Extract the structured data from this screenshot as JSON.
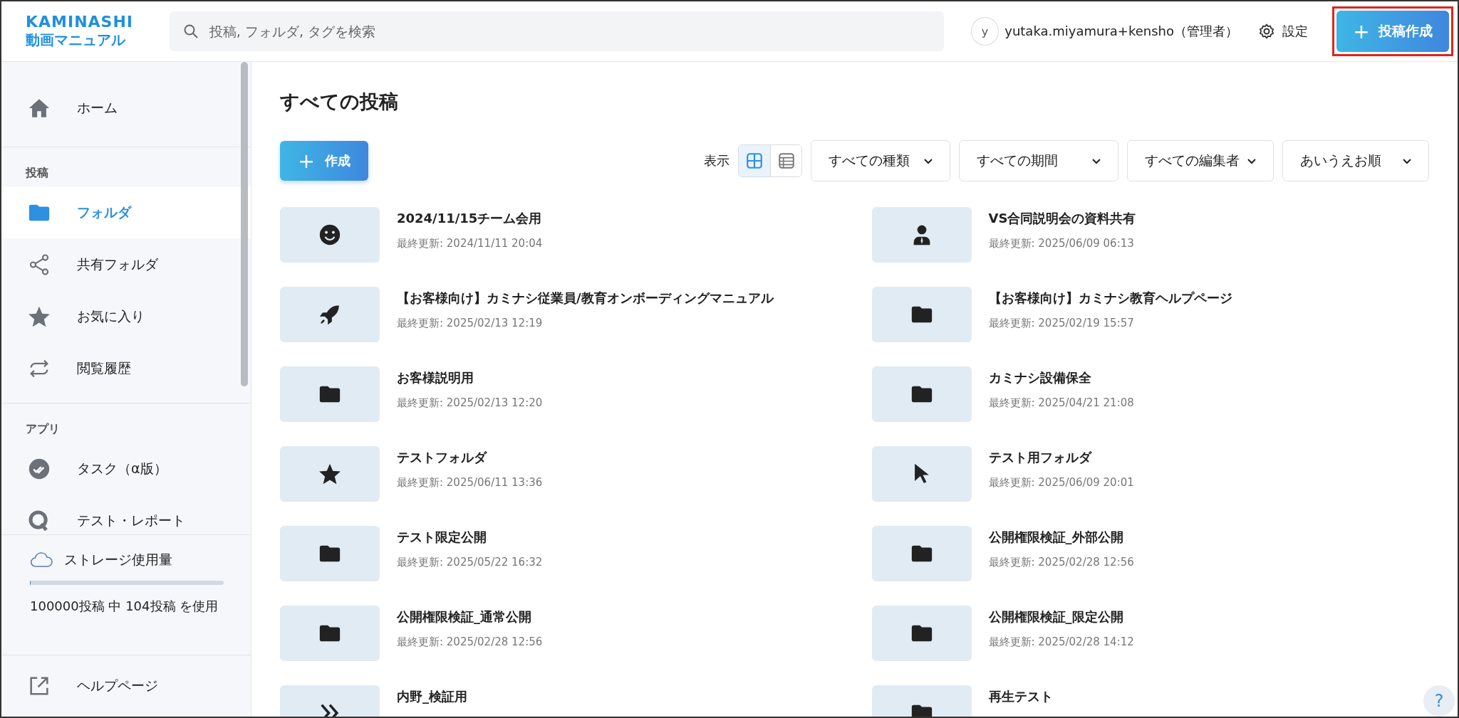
{
  "header": {
    "logo": "KAMINASHI",
    "logo_sub": "動画マニュアル",
    "search": {
      "placeholder": "投稿, フォルダ, タグを検索"
    },
    "user": {
      "initial": "y",
      "name": "yutaka.miyamura+kensho（管理者）"
    },
    "settings": "設定",
    "create_post": {
      "label": "投稿作成",
      "plus": "+",
      "highlighted": true
    }
  },
  "sidebar": {
    "sections": [
      {
        "items": [
          {
            "label": "ホーム",
            "kind": "home",
            "selected": false
          }
        ]
      },
      {
        "heading": "投稿",
        "items": [
          {
            "label": "フォルダ",
            "kind": "folder",
            "selected": true
          },
          {
            "label": "共有フォルダ",
            "kind": "share",
            "selected": false
          },
          {
            "label": "お気に入り",
            "kind": "star",
            "selected": false
          },
          {
            "label": "閲覧履歴",
            "kind": "history",
            "selected": false
          }
        ]
      },
      {
        "heading": "アプリ",
        "items": [
          {
            "label": "タスク（α版）",
            "kind": "task",
            "selected": false
          },
          {
            "label": "テスト・レポート",
            "kind": "quiz",
            "selected": false
          }
        ]
      }
    ],
    "storage": {
      "title": "ストレージ使用量",
      "level": 0.002,
      "usage": "100000投稿 中 104投稿 を使用"
    },
    "help": "ヘルプページ"
  },
  "main": {
    "title": "すべての投稿",
    "create": {
      "plus": "+",
      "label": "作成"
    },
    "view_label": "表示",
    "views": [
      {
        "kind": "grid",
        "selected": true
      },
      {
        "kind": "list",
        "selected": false
      }
    ],
    "filters": [
      "すべての種類",
      "すべての期間",
      "すべての編集者",
      "あいうえお順"
    ],
    "posts": [
      {
        "kind": "smile",
        "title": "2024/11/15チーム会用",
        "updated": "最終更新: 2024/11/11 20:04"
      },
      {
        "kind": "person",
        "title": "VS合同説明会の資料共有",
        "updated": "最終更新: 2025/06/09 06:13"
      },
      {
        "kind": "rocket",
        "title": "【お客様向け】カミナシ従業員/教育オンボーディングマニュアル",
        "updated": "最終更新: 2025/02/13 12:19"
      },
      {
        "kind": "folder",
        "title": "【お客様向け】カミナシ教育ヘルプページ",
        "updated": "最終更新: 2025/02/19 15:57"
      },
      {
        "kind": "folder",
        "title": "お客様説明用",
        "updated": "最終更新: 2025/02/13 12:20"
      },
      {
        "kind": "folder",
        "title": "カミナシ設備保全",
        "updated": "最終更新: 2025/04/21 21:08"
      },
      {
        "kind": "star",
        "title": "テストフォルダ",
        "updated": "最終更新: 2025/06/11 13:36"
      },
      {
        "kind": "pointer",
        "title": "テスト用フォルダ",
        "updated": "最終更新: 2025/06/09 20:01"
      },
      {
        "kind": "folder",
        "title": "テスト限定公開",
        "updated": "最終更新: 2025/05/22 16:32"
      },
      {
        "kind": "folder",
        "title": "公開権限検証_外部公開",
        "updated": "最終更新: 2025/02/28 12:56"
      },
      {
        "kind": "folder",
        "title": "公開権限検証_通常公開",
        "updated": "最終更新: 2025/02/28 12:56"
      },
      {
        "kind": "folder",
        "title": "公開権限検証_限定公開",
        "updated": "最終更新: 2025/02/28 14:12"
      },
      {
        "kind": "chevrons",
        "title": "内野_検証用"
      },
      {
        "kind": "folder",
        "title": "再生テスト"
      }
    ]
  },
  "help_button": "?"
}
